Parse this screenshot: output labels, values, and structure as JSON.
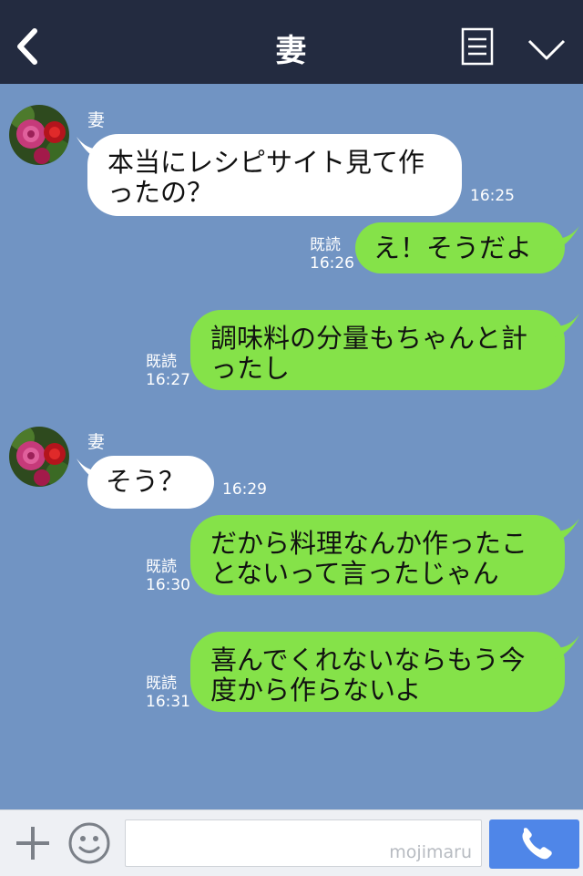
{
  "header": {
    "title": "妻"
  },
  "messages": [
    {
      "side": "in",
      "sender": "妻",
      "text": "本当にレシピサイト見て作\nったの？",
      "time": "16:25"
    },
    {
      "side": "out",
      "read": "既読",
      "text": "え！そうだよ",
      "time": "16:26"
    },
    {
      "side": "out",
      "read": "既読",
      "text": "調味料の分量もちゃんと計\nったし",
      "time": "16:27"
    },
    {
      "side": "in",
      "sender": "妻",
      "text": "そう？",
      "time": "16:29"
    },
    {
      "side": "out",
      "read": "既読",
      "text": "だから料理なんか作ったこ\nとないって言ったじゃん",
      "time": "16:30"
    },
    {
      "side": "out",
      "read": "既読",
      "text": "喜んでくれないならもう今\n度から作らないよ",
      "time": "16:31"
    }
  ],
  "footer": {
    "watermark": "mojimaru"
  }
}
